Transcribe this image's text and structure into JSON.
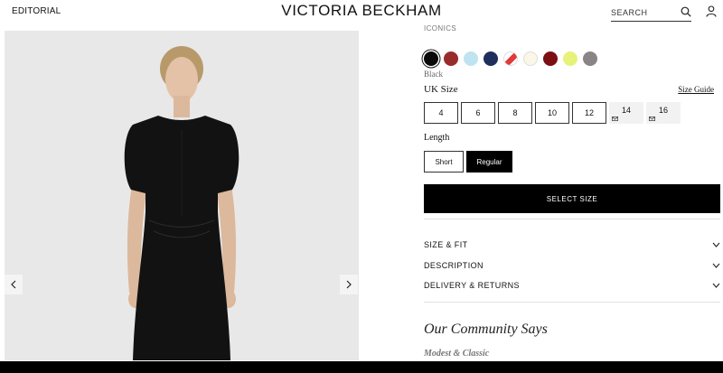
{
  "header": {
    "nav_editorial": "EDITORIAL",
    "brand": "VICTORIA BECKHAM",
    "search_placeholder": "SEARCH"
  },
  "product": {
    "collection": "ICONICS",
    "selected_color": "Black",
    "swatches": [
      {
        "name": "black",
        "color": "#0a0a0a",
        "selected": true
      },
      {
        "name": "burgundy-red",
        "color": "#9a2b2b"
      },
      {
        "name": "light-blue",
        "color": "#bfe3f0"
      },
      {
        "name": "navy",
        "color": "#1f2f5c"
      },
      {
        "name": "red-white",
        "color": "#f4c0c0"
      },
      {
        "name": "cream",
        "color": "#fbf7e6"
      },
      {
        "name": "dark-red",
        "color": "#7c0f14"
      },
      {
        "name": "lime",
        "color": "#e6f27a"
      },
      {
        "name": "grey",
        "color": "#8a8486"
      }
    ],
    "size_label": "UK Size",
    "size_guide": "Size Guide",
    "sizes": [
      {
        "label": "4",
        "available": true
      },
      {
        "label": "6",
        "available": true
      },
      {
        "label": "8",
        "available": true
      },
      {
        "label": "10",
        "available": true
      },
      {
        "label": "12",
        "available": true
      },
      {
        "label": "14",
        "available": false
      },
      {
        "label": "16",
        "available": false
      }
    ],
    "length_label": "Length",
    "lengths": [
      {
        "label": "Short",
        "active": false
      },
      {
        "label": "Regular",
        "active": true
      }
    ],
    "select_button": "SELECT SIZE",
    "accordion": [
      "SIZE & FIT",
      "DESCRIPTION",
      "DELIVERY & RETURNS"
    ],
    "community_heading": "Our Community Says",
    "review_title": "Modest & Classic"
  },
  "colors": {
    "accent": "#000000",
    "gallery_bg": "#e8e8e8"
  }
}
